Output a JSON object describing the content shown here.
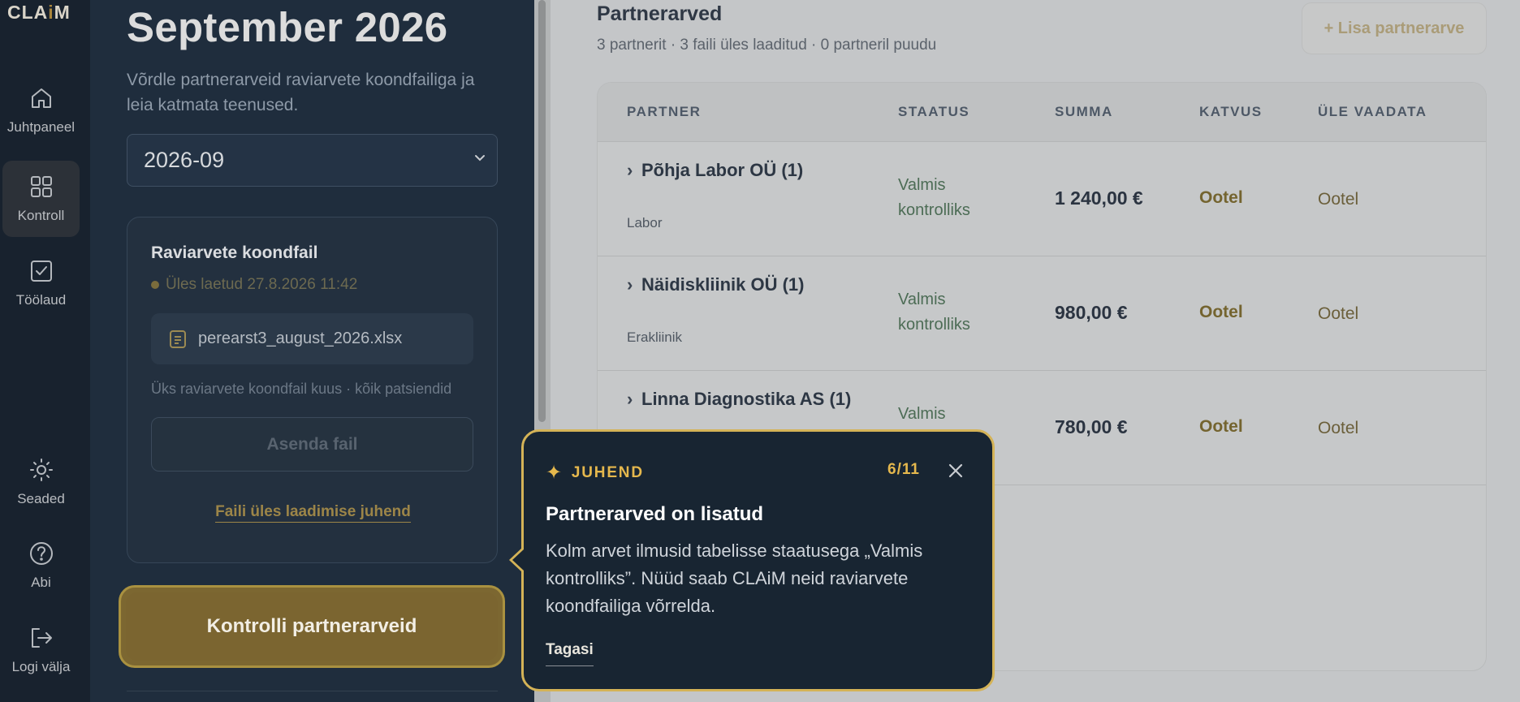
{
  "app": {
    "logo_prefix": "CLA",
    "logo_accent": "i",
    "logo_suffix": "M"
  },
  "nav": {
    "dashboard": "Juhtpaneel",
    "control": "Kontroll",
    "worktable": "Töölaud",
    "settings": "Seaded",
    "help": "Abi",
    "logout": "Logi välja"
  },
  "panel": {
    "month_title": "September 2026",
    "month_subtitle": "Võrdle partnerarveid raviarvete koondfailiga ja leia katmata teenused.",
    "month_select_value": "2026-09",
    "upload": {
      "title": "Raviarvete koondfail",
      "status": "Üles laetud 27.8.2026 11:42",
      "file_name": "perearst3_august_2026.xlsx",
      "note": "Üks raviarvete koondfail kuus · kõik patsiendid",
      "replace_label": "Asenda fail",
      "guide_link": "Faili üles laadimise juhend"
    },
    "check_button": "Kontrolli partnerarveid"
  },
  "partners": {
    "title": "Partnerarved",
    "summary": "3 partnerit · 3 faili üles laaditud · 0 partneril puudu",
    "add_button": "+ Lisa partnerarve",
    "columns": [
      "PARTNER",
      "STAATUS",
      "SUMMA",
      "KATVUS",
      "ÜLE VAADATA"
    ],
    "rows": [
      {
        "name": "Põhja Labor OÜ (1)",
        "type": "Labor",
        "status": "Valmis kontrolliks",
        "amount": "1 240,00 €",
        "coverage": "Ootel",
        "review": "Ootel"
      },
      {
        "name": "Näidiskliinik OÜ (1)",
        "type": "Erakliinik",
        "status": "Valmis kontrolliks",
        "amount": "980,00 €",
        "coverage": "Ootel",
        "review": "Ootel"
      },
      {
        "name": "Linna Diagnostika AS (1)",
        "type": "",
        "status": "Valmis",
        "amount": "780,00 €",
        "coverage": "Ootel",
        "review": "Ootel"
      }
    ]
  },
  "tooltip": {
    "label": "JUHEND",
    "step": "6/11",
    "title": "Partnerarved on lisatud",
    "body": "Kolm arvet ilmusid tabelisse staatusega „Valmis kontrolliks”. Nüüd saab CLAiM neid raviarvete koondfailiga võrrelda.",
    "back_label": "Tagasi"
  },
  "icons": {
    "dashboard": "home-icon",
    "control": "grid-icon",
    "worktable": "checkbox-icon",
    "settings": "sun-gear-icon",
    "help": "question-icon",
    "logout": "logout-icon",
    "file": "document-icon",
    "tooltip_label": "sparkle-icon",
    "close": "close-icon",
    "select": "chevron-down-icon",
    "row_toggle": "chevron-right-icon"
  },
  "colors": {
    "rail_bg": "#18222e",
    "panel_bg": "#1f2d3d",
    "accent_gold": "#d4b357",
    "button_gold": "#7b6530",
    "status_green": "#4c6c55",
    "overlay_gray": "#c6c8c9"
  }
}
